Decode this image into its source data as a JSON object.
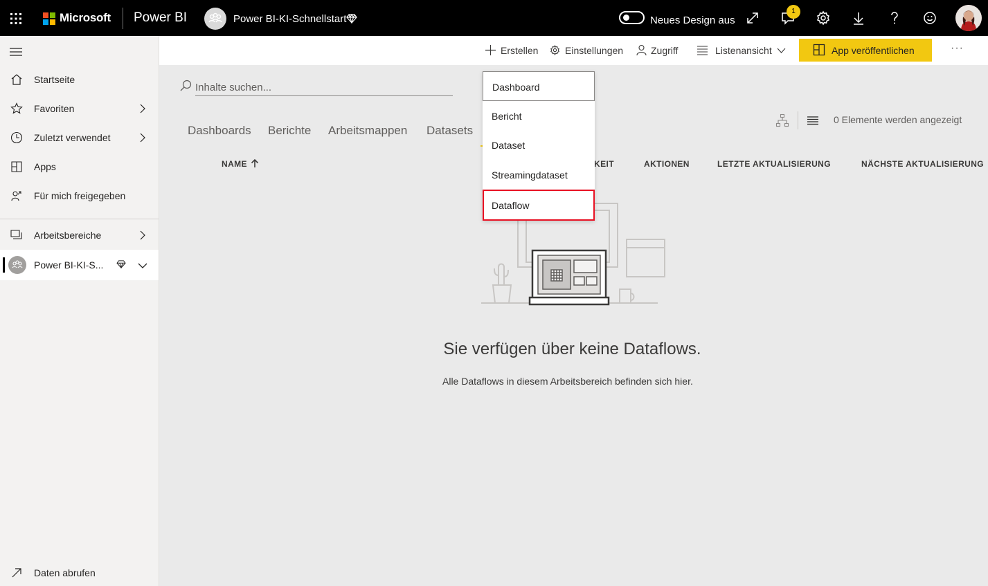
{
  "header": {
    "brand": "Microsoft",
    "app_name": "Power BI",
    "workspace_name": "Power BI-KI-Schnellstart",
    "design_toggle_label": "Neues Design aus",
    "notification_count": "1",
    "icons": [
      "waffle-icon",
      "expand-icon",
      "notification-icon",
      "settings-icon",
      "download-icon",
      "help-icon",
      "feedback-icon",
      "user-avatar"
    ]
  },
  "sidebar": {
    "items": [
      {
        "label": "Startseite",
        "icon": "home-icon"
      },
      {
        "label": "Favoriten",
        "icon": "star-icon"
      },
      {
        "label": "Zuletzt verwendet",
        "icon": "clock-icon"
      },
      {
        "label": "Apps",
        "icon": "apps-icon"
      },
      {
        "label": "Für mich freigegeben",
        "icon": "shared-icon"
      },
      {
        "label": "Arbeitsbereiche",
        "icon": "workspaces-icon"
      },
      {
        "label": "Power BI-KI-S...",
        "icon": "workspace-avatar"
      }
    ],
    "footer_label": "Daten abrufen"
  },
  "commandbar": {
    "create": "Erstellen",
    "settings": "Einstellungen",
    "access": "Zugriff",
    "view": "Listenansicht",
    "publish": "App veröffentlichen",
    "more": "···"
  },
  "search": {
    "placeholder": "Inhalte suchen..."
  },
  "tabs": [
    "Dashboards",
    "Berichte",
    "Arbeitsmappen",
    "Datasets"
  ],
  "toolbar": {
    "count_text": "0 Elemente werden angezeigt"
  },
  "columns": {
    "name": "NAME",
    "partial": "KEIT",
    "actions": "AKTIONEN",
    "last_refresh": "LETZTE AKTUALISIERUNG",
    "next_refresh": "NÄCHSTE AKTUALISIERUNG"
  },
  "create_menu": {
    "items": [
      "Dashboard",
      "Bericht",
      "Dataset",
      "Streamingdataset",
      "Dataflow"
    ],
    "highlighted": "Dataflow"
  },
  "empty_state": {
    "title": "Sie verfügen über keine Dataflows.",
    "subtitle": "Alle Dataflows in diesem Arbeitsbereich befinden sich hier."
  },
  "colors": {
    "accent_yellow": "#f2c811",
    "highlight_red": "#e81123",
    "topbar": "#000000"
  }
}
